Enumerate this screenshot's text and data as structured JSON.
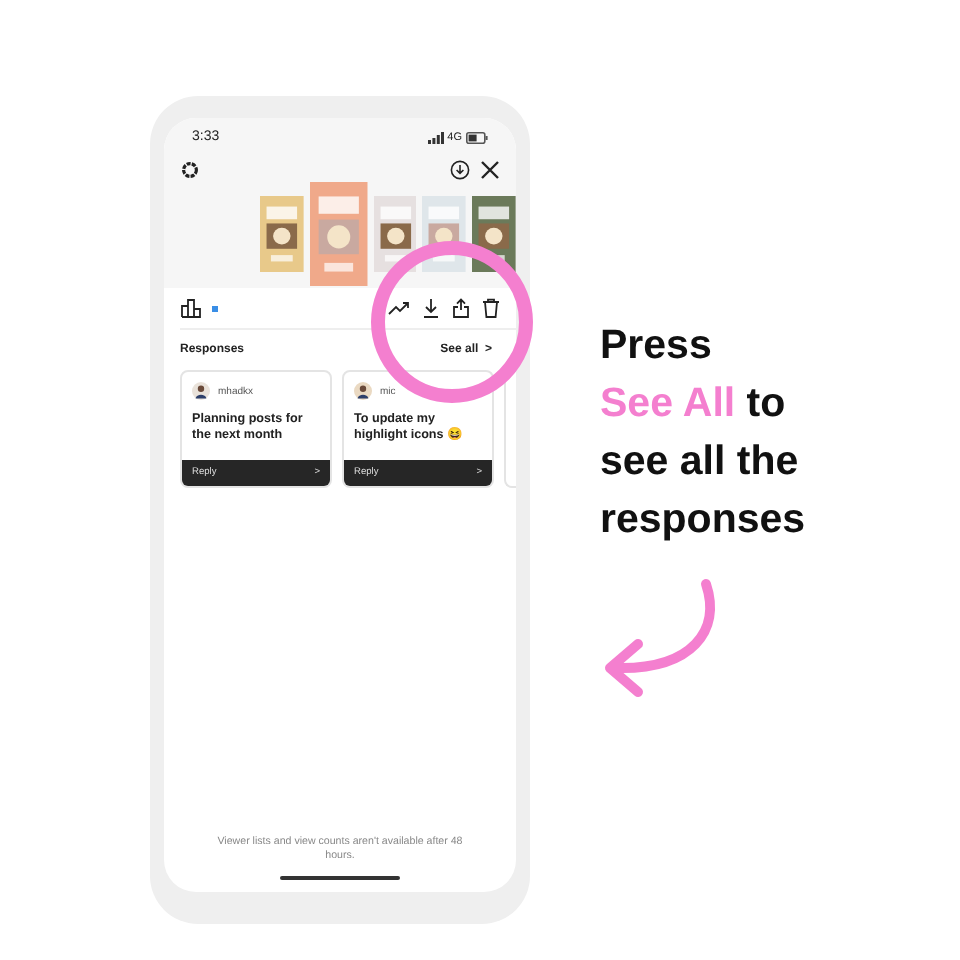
{
  "status_bar": {
    "time": "3:33",
    "network": "4G"
  },
  "thumbnails": [
    {
      "selected": false
    },
    {
      "selected": true
    },
    {
      "selected": false
    },
    {
      "selected": false
    },
    {
      "selected": false
    }
  ],
  "toolbar": {
    "new_dot": true
  },
  "responses": {
    "title": "Responses",
    "see_all": "See all",
    "see_all_arrow": ">"
  },
  "cards": [
    {
      "username": "mhadkx",
      "text": "Planning posts for the next month",
      "reply": "Reply",
      "arrow": ">"
    },
    {
      "username": "mic",
      "text": "To update my highlight icons 😆",
      "reply": "Reply",
      "arrow": ">"
    }
  ],
  "footer_note": "Viewer lists and view counts aren't available after 48 hours.",
  "callout": {
    "lines": [
      [
        {
          "text": "Press",
          "highlight": false
        }
      ],
      [
        {
          "text": "See All",
          "highlight": true
        },
        {
          "text": " to",
          "highlight": false
        }
      ],
      [
        {
          "text": "see all the",
          "highlight": false
        }
      ],
      [
        {
          "text": "responses",
          "highlight": false
        }
      ]
    ]
  }
}
